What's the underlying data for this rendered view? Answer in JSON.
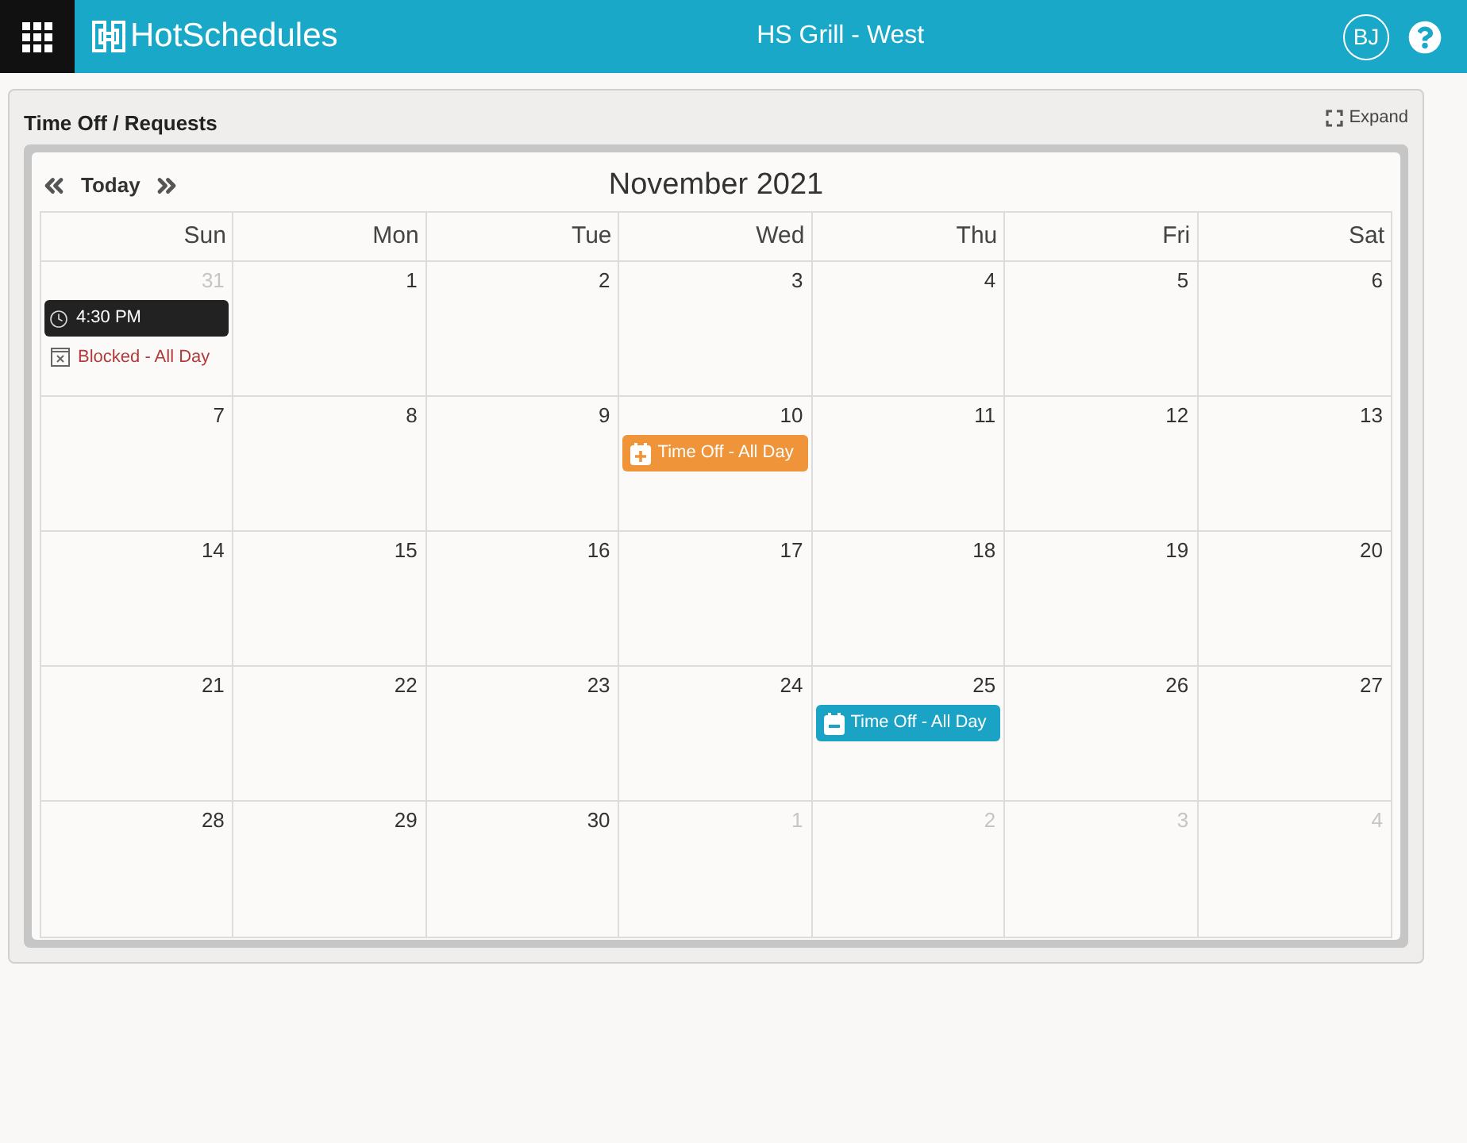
{
  "header": {
    "app_name": "HotSchedules",
    "location": "HS Grill - West",
    "user_initials": "BJ"
  },
  "panel": {
    "title": "Time Off / Requests",
    "expand_label": "Expand"
  },
  "calendar": {
    "today_label": "Today",
    "month_title": "November 2021",
    "weekdays": [
      "Sun",
      "Mon",
      "Tue",
      "Wed",
      "Thu",
      "Fri",
      "Sat"
    ],
    "weeks": [
      [
        {
          "day": "31",
          "other_month": true,
          "events": [
            {
              "kind": "shift",
              "label": "4:30 PM"
            },
            {
              "kind": "blocked",
              "label": "Blocked - All Day"
            }
          ]
        },
        {
          "day": "1",
          "other_month": false
        },
        {
          "day": "2",
          "other_month": false
        },
        {
          "day": "3",
          "other_month": false
        },
        {
          "day": "4",
          "other_month": false
        },
        {
          "day": "5",
          "other_month": false
        },
        {
          "day": "6",
          "other_month": false
        }
      ],
      [
        {
          "day": "7",
          "other_month": false
        },
        {
          "day": "8",
          "other_month": false
        },
        {
          "day": "9",
          "other_month": false
        },
        {
          "day": "10",
          "other_month": false,
          "events": [
            {
              "kind": "pending",
              "label": "Time Off - All Day",
              "color": "#f0943a"
            }
          ]
        },
        {
          "day": "11",
          "other_month": false
        },
        {
          "day": "12",
          "other_month": false
        },
        {
          "day": "13",
          "other_month": false
        }
      ],
      [
        {
          "day": "14",
          "other_month": false
        },
        {
          "day": "15",
          "other_month": false
        },
        {
          "day": "16",
          "other_month": false
        },
        {
          "day": "17",
          "other_month": false
        },
        {
          "day": "18",
          "other_month": false
        },
        {
          "day": "19",
          "other_month": false
        },
        {
          "day": "20",
          "other_month": false
        }
      ],
      [
        {
          "day": "21",
          "other_month": false
        },
        {
          "day": "22",
          "other_month": false
        },
        {
          "day": "23",
          "other_month": false
        },
        {
          "day": "24",
          "other_month": false
        },
        {
          "day": "25",
          "other_month": false,
          "events": [
            {
              "kind": "approved",
              "label": "Time Off - All Day",
              "color": "#1ba3c6"
            }
          ]
        },
        {
          "day": "26",
          "other_month": false
        },
        {
          "day": "27",
          "other_month": false
        }
      ],
      [
        {
          "day": "28",
          "other_month": false
        },
        {
          "day": "29",
          "other_month": false
        },
        {
          "day": "30",
          "other_month": false
        },
        {
          "day": "1",
          "other_month": true
        },
        {
          "day": "2",
          "other_month": true
        },
        {
          "day": "3",
          "other_month": true
        },
        {
          "day": "4",
          "other_month": true
        }
      ]
    ]
  }
}
